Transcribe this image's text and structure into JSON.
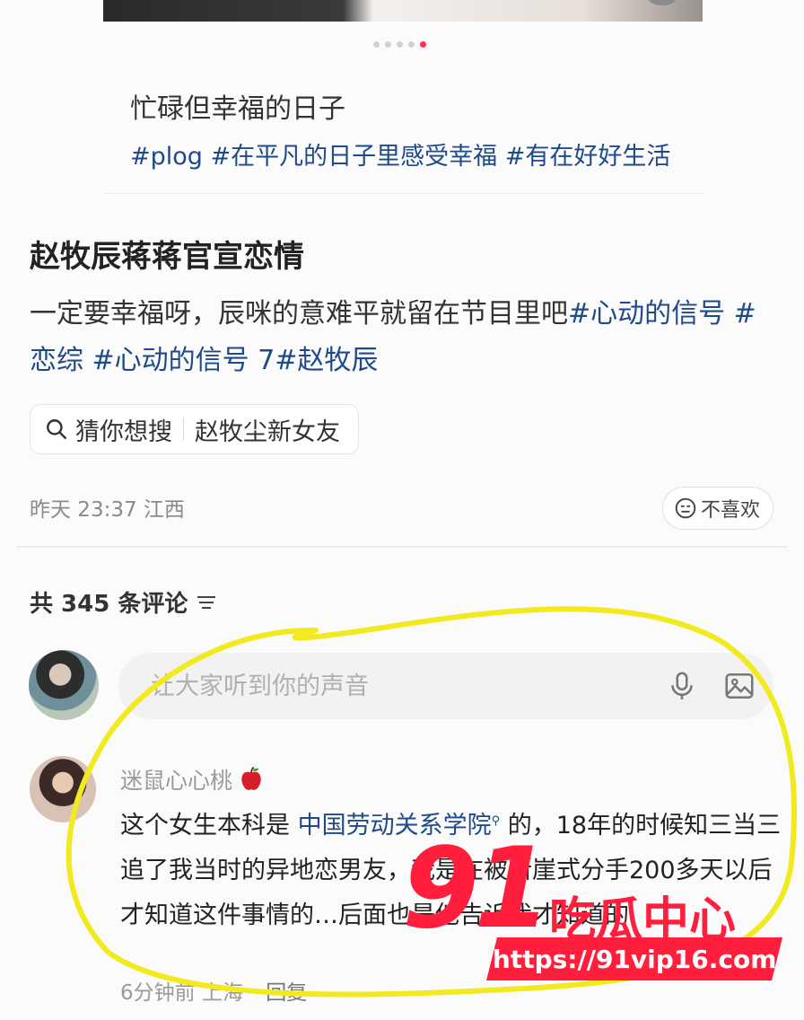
{
  "previous_post": {
    "title": "忙碌但幸福的日子",
    "tags": "#plog #在平凡的日子里感受幸福 #有在好好生活",
    "carousel": {
      "total": 5,
      "active": 5
    }
  },
  "post": {
    "title": "赵牧辰蒋蒋官宣恋情",
    "body_text": "一定要幸福呀，辰咪的意难平就留在节目里吧",
    "body_tags": "#心动的信号 #恋综 #心动的信号 7#赵牧辰",
    "guess_label": "猜你想搜",
    "guess_query": "赵牧尘新女友",
    "time": "昨天 23:37",
    "location": "江西",
    "dislike_label": "不喜欢"
  },
  "comments": {
    "count_text": "共 345 条评论",
    "input_placeholder": "让大家听到你的声音",
    "items": [
      {
        "username": "迷鼠心心桃",
        "text_before": "这个女生本科是 ",
        "link_text": "中国劳动关系学院",
        "text_after": " 的，18年的时候知三当三追了我当时的异地恋男友，我是在被断崖式分手200多天以后才知道这件事情的…后面也是他告诉我才知道的",
        "time": "6分钟前",
        "location": "上海",
        "reply_label": "回复"
      }
    ]
  },
  "watermark": {
    "number": "91",
    "text": "吃瓜中心",
    "url": "https://91vip16.com"
  },
  "colors": {
    "tag": "#1f4a8a",
    "accent": "#ff2e4d",
    "highlight": "#f2ea1f"
  }
}
